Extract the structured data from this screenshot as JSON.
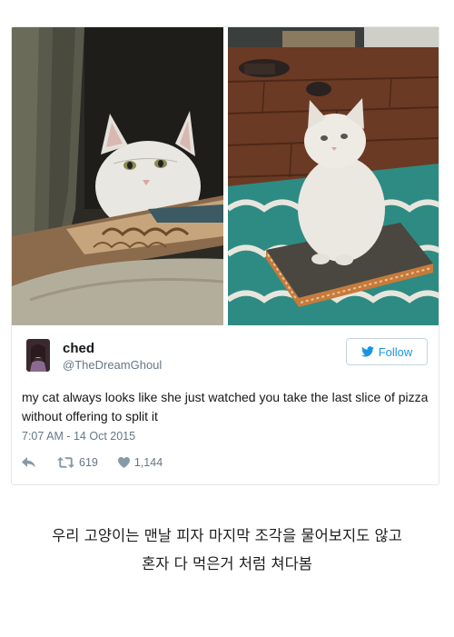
{
  "tweet": {
    "display_name": "ched",
    "handle": "@TheDreamGhoul",
    "follow_label": "Follow",
    "text": "my cat always looks like she just watched you take the last slice of pizza without offering to split it",
    "timestamp": "7:07 AM - 14 Oct 2015",
    "retweet_count": "619",
    "like_count": "1,144"
  },
  "photos": {
    "left_icon": "cat-photo-icon",
    "right_icon": "cat-photo-icon"
  },
  "caption": {
    "line1": "우리 고양이는 맨날 피자 마지막 조각을 물어보지도 않고",
    "line2": "혼자 다 먹은거 처럼 쳐다봄"
  },
  "colors": {
    "accent": "#1b95e0",
    "text": "#14171a",
    "muted": "#657786",
    "border": "#e7e7e7"
  }
}
